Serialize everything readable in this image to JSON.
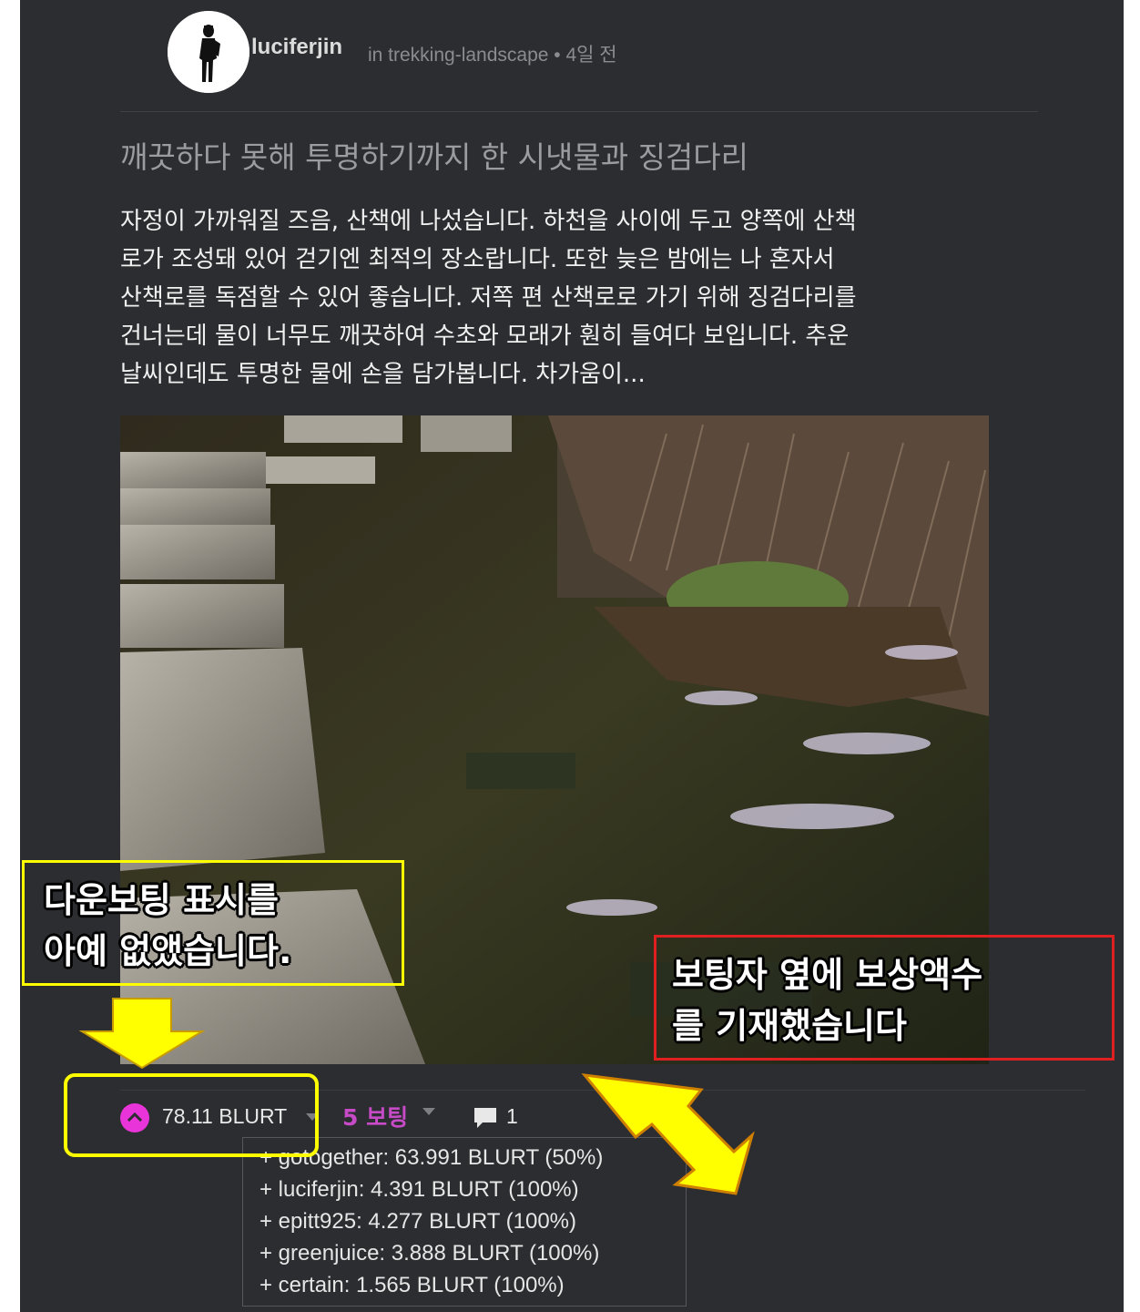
{
  "post": {
    "author": "luciferjin",
    "meta": "in trekking-landscape • 4일 전",
    "title": "깨끗하다 못해 투명하기까지 한 시냇물과 징검다리",
    "body_lines": [
      "자정이 가까워질 즈음, 산책에 나섰습니다. 하천을 사이에 두고 양쪽에 산책",
      "로가 조성돼 있어 걷기엔 최적의 장소랍니다. 또한 늦은 밤에는 나 혼자서",
      "산책로를 독점할 수 있어 좋습니다. 저쪽 편 산책로로 가기 위해 징검다리를",
      "건너는데 물이 너무도 깨끗하여 수초와 모래가 훤히 들여다 보입니다. 추운",
      "날씨인데도 투명한 물에 손을 담가봅니다. 차가움이..."
    ]
  },
  "footer": {
    "payout": "78.11 BLURT",
    "votes_label": "5 보팅",
    "comments": "1"
  },
  "voters": [
    "+ gotogether: 63.991 BLURT (50%)",
    "+ luciferjin: 4.391 BLURT (100%)",
    "+ epitt925: 4.277 BLURT (100%)",
    "+ greenjuice: 3.888 BLURT (100%)",
    "+ certain: 1.565 BLURT (100%)"
  ],
  "annotations": {
    "left_note": [
      "다운보팅 표시를",
      "아예 없앴습니다."
    ],
    "right_note": [
      "보팅자 옆에 보상액수",
      "를 기재했습니다"
    ]
  },
  "colors": {
    "panel": "#2b2d30",
    "vote_accent": "#e834d8",
    "votes_text": "#c74ac6",
    "yellow": "#ffff00",
    "red_box": "#e02020"
  }
}
